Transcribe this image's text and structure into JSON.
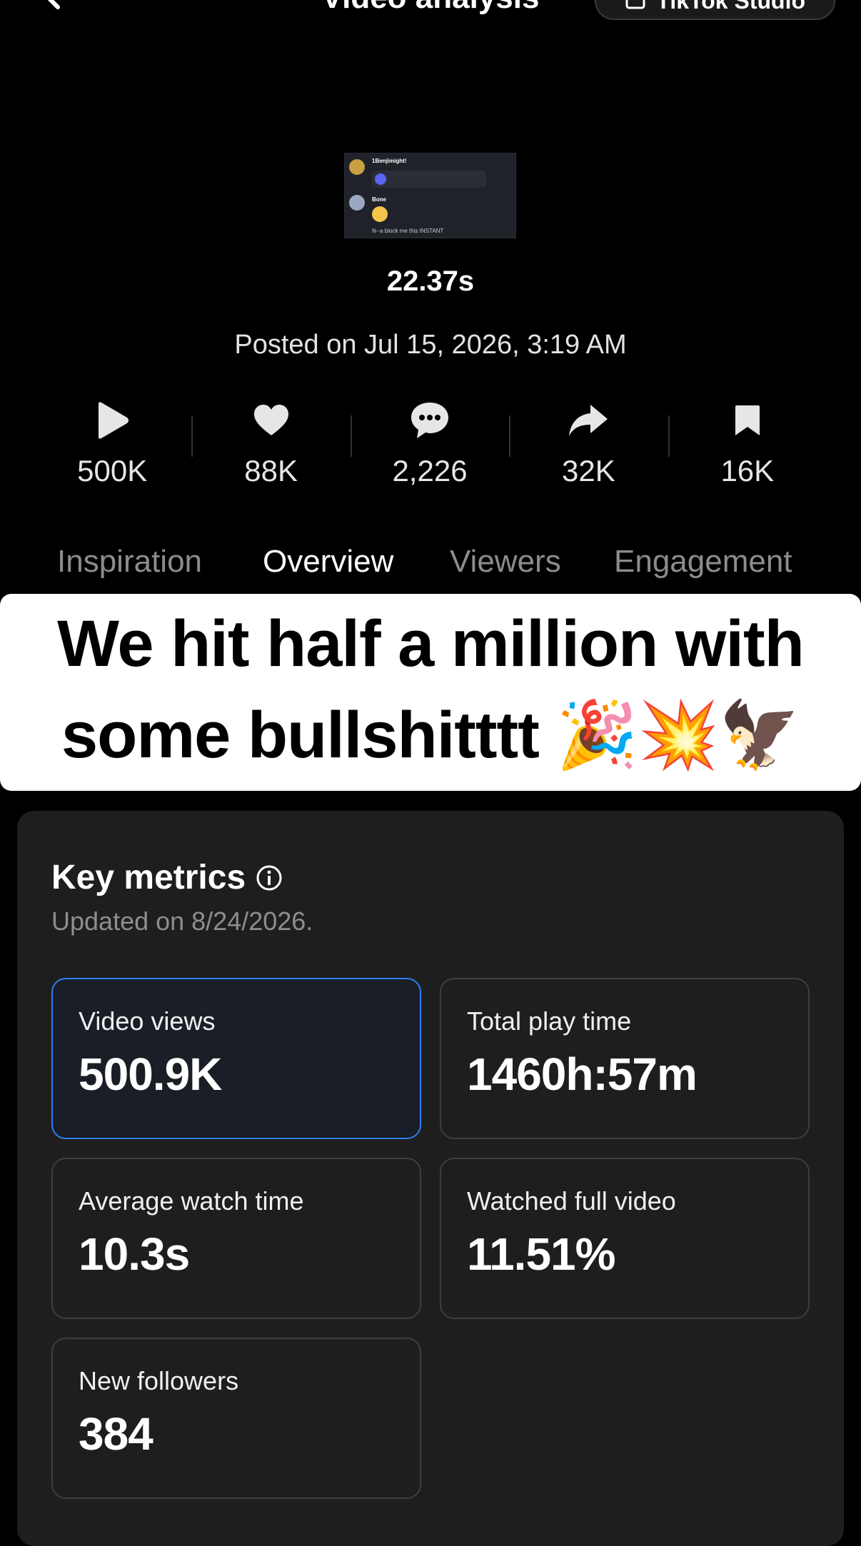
{
  "header": {
    "title": "Video analysis",
    "studio_button": "TikTok Studio"
  },
  "video": {
    "duration": "22.37s",
    "posted": "Posted on Jul 15, 2026, 3:19 AM"
  },
  "stats": [
    {
      "icon": "play-icon",
      "value": "500K"
    },
    {
      "icon": "heart-icon",
      "value": "88K"
    },
    {
      "icon": "comment-icon",
      "value": "2,226"
    },
    {
      "icon": "share-icon",
      "value": "32K"
    },
    {
      "icon": "bookmark-icon",
      "value": "16K"
    }
  ],
  "tabs": [
    {
      "label": "Inspiration",
      "active": false
    },
    {
      "label": "Overview",
      "active": true
    },
    {
      "label": "Viewers",
      "active": false
    },
    {
      "label": "Engagement",
      "active": false
    }
  ],
  "banner": {
    "line1": "We hit half a million with",
    "line2": "some bullshitttt 🎉💥🦅"
  },
  "key_metrics": {
    "title": "Key metrics",
    "updated": "Updated on 8/24/2026.",
    "metrics": [
      {
        "label": "Video views",
        "value": "500.9K",
        "selected": true
      },
      {
        "label": "Total play time",
        "value": "1460h:57m",
        "selected": false
      },
      {
        "label": "Average watch time",
        "value": "10.3s",
        "selected": false
      },
      {
        "label": "Watched full video",
        "value": "11.51%",
        "selected": false
      },
      {
        "label": "New followers",
        "value": "384",
        "selected": false
      }
    ]
  },
  "colors": {
    "background": "#000000",
    "card": "#1e1e1e",
    "selected_border": "#2d7ff0"
  }
}
